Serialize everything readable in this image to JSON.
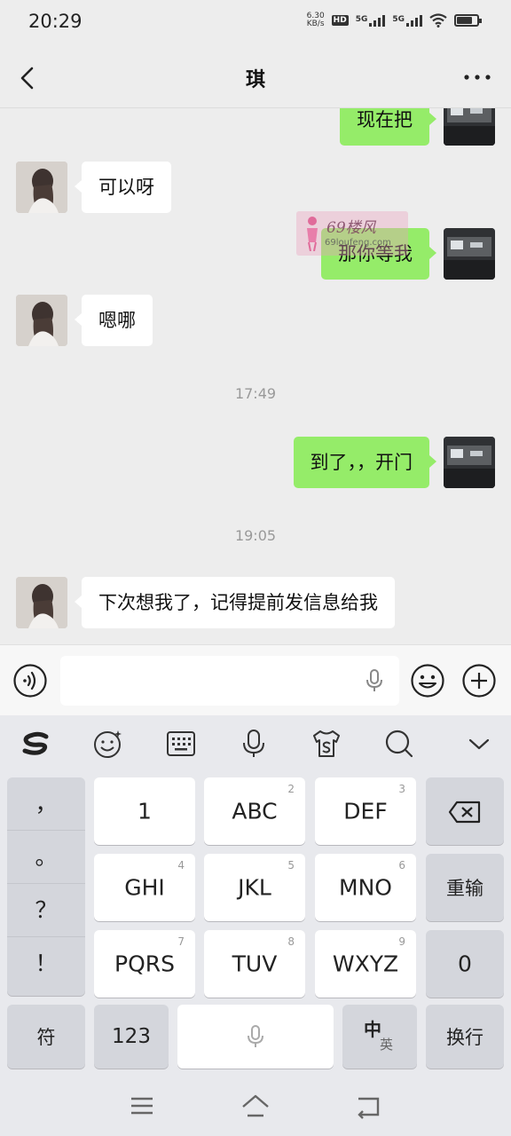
{
  "status_bar": {
    "time": "20:29",
    "net_speed_value": "6.30",
    "net_speed_unit": "KB/s",
    "hd_label": "HD",
    "sim1_label": "5G",
    "sim2_label": "5G"
  },
  "nav": {
    "title": "琪"
  },
  "messages": [
    {
      "side": "right",
      "text": "现在把"
    },
    {
      "side": "left",
      "text": "可以呀"
    },
    {
      "side": "right",
      "text": "那你等我"
    },
    {
      "side": "left",
      "text": "嗯哪"
    },
    {
      "side": "time",
      "text": "17:49"
    },
    {
      "side": "right",
      "text": "到了，，开门"
    },
    {
      "side": "time",
      "text": "19:05"
    },
    {
      "side": "left",
      "text": "下次想我了，记得提前发信息给我"
    }
  ],
  "watermark": {
    "main": "69楼风",
    "sub": "69loufeng.com"
  },
  "input": {
    "value": ""
  },
  "keyboard": {
    "punctuation": [
      "，",
      "。",
      "？",
      "！"
    ],
    "row1": [
      {
        "label": "1",
        "num": ""
      },
      {
        "label": "ABC",
        "num": "2"
      },
      {
        "label": "DEF",
        "num": "3"
      }
    ],
    "row2": [
      {
        "label": "GHI",
        "num": "4"
      },
      {
        "label": "JKL",
        "num": "5"
      },
      {
        "label": "MNO",
        "num": "6"
      }
    ],
    "row3": [
      {
        "label": "PQRS",
        "num": "7"
      },
      {
        "label": "TUV",
        "num": "8"
      },
      {
        "label": "WXYZ",
        "num": "9"
      }
    ],
    "reenter_label": "重输",
    "zero_label": "0",
    "symbol_label": "符",
    "numbers_label": "123",
    "lang_main": "中",
    "lang_alt": "英",
    "newline_label": "换行"
  },
  "colors": {
    "sent_bubble": "#95ec69",
    "received_bubble": "#ffffff",
    "background": "#ededed"
  },
  "icons": [
    "back-icon",
    "more-icon",
    "voice-icon",
    "mic-icon",
    "emoji-icon",
    "plus-icon",
    "sogou-logo-icon",
    "emoji-face-icon",
    "keyboard-icon",
    "microphone-icon",
    "skin-icon",
    "search-icon",
    "collapse-icon",
    "backspace-icon",
    "menu-icon",
    "home-icon",
    "return-icon"
  ]
}
